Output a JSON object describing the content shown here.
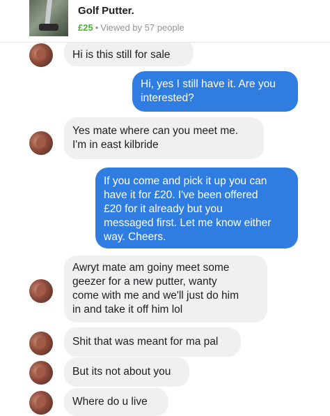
{
  "listing": {
    "title": "Golf Putter.",
    "price": "£25",
    "separator": "•",
    "views": "Viewed by 57 people"
  },
  "messages": [
    {
      "from": "buyer",
      "text": "Hi is this still for sale"
    },
    {
      "from": "seller",
      "text": "Hi, yes I still have it. Are you\ninterested?"
    },
    {
      "from": "buyer",
      "text": "Yes mate where can you meet me.\nI'm in east kilbride"
    },
    {
      "from": "seller",
      "text": "If you come and pick it up you can\nhave it for £20. I've been offered\n£20 for it already but you\nmessaged first. Let me know either\nway. Cheers."
    },
    {
      "from": "buyer",
      "text": "Awryt mate am goiny meet some\ngeezer for a new putter, wanty\ncome with me and we'll just do him\nin and take it off him lol"
    },
    {
      "from": "buyer",
      "text": "Shit that was meant for ma pal"
    },
    {
      "from": "buyer",
      "text": "But its not about you"
    },
    {
      "from": "buyer",
      "text": "Where do u live"
    }
  ],
  "colors": {
    "outgoing_bubble": "#2f7de1",
    "incoming_bubble": "#f1f0f0",
    "price": "#42b72a"
  }
}
